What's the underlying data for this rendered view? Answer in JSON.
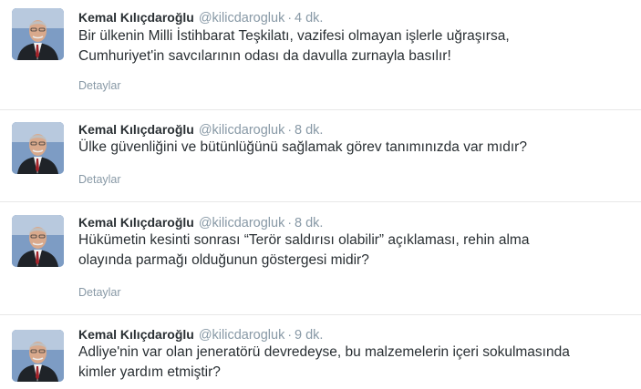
{
  "tweets": [
    {
      "name": "Kemal Kılıçdaroğlu",
      "handle": "@kilicdarogluk",
      "separator": "·",
      "time": "4 dk.",
      "text_lines": [
        "Bir ülkenin Milli İstihbarat Teşkilatı, vazifesi olmayan işlerle uğraşırsa,",
        "Cumhuriyet'in savcılarının odası da davulla zurnayla basılır!"
      ],
      "details_label": "Detaylar"
    },
    {
      "name": "Kemal Kılıçdaroğlu",
      "handle": "@kilicdarogluk",
      "separator": "·",
      "time": "8 dk.",
      "text_lines": [
        "Ülke güvenliğini ve bütünlüğünü sağlamak görev tanımınızda var mıdır?"
      ],
      "details_label": "Detaylar"
    },
    {
      "name": "Kemal Kılıçdaroğlu",
      "handle": "@kilicdarogluk",
      "separator": "·",
      "time": "8 dk.",
      "text_lines": [
        "Hükümetin kesinti sonrası “Terör saldırısı olabilir” açıklaması, rehin alma",
        "olayında parmağı olduğunun göstergesi midir?"
      ],
      "details_label": "Detaylar"
    },
    {
      "name": "Kemal Kılıçdaroğlu",
      "handle": "@kilicdarogluk",
      "separator": "·",
      "time": "9 dk.",
      "text_lines": [
        "Adliye'nin var olan jeneratörü devredeyse, bu malzemelerin içeri sokulmasında",
        "kimler yardım etmiştir?"
      ],
      "details_label": "Detaylar"
    }
  ],
  "colors": {
    "name": "#292f33",
    "meta": "#8899a6",
    "divider": "#e8e8e8",
    "avatar_bg": "#6e8fb5"
  }
}
